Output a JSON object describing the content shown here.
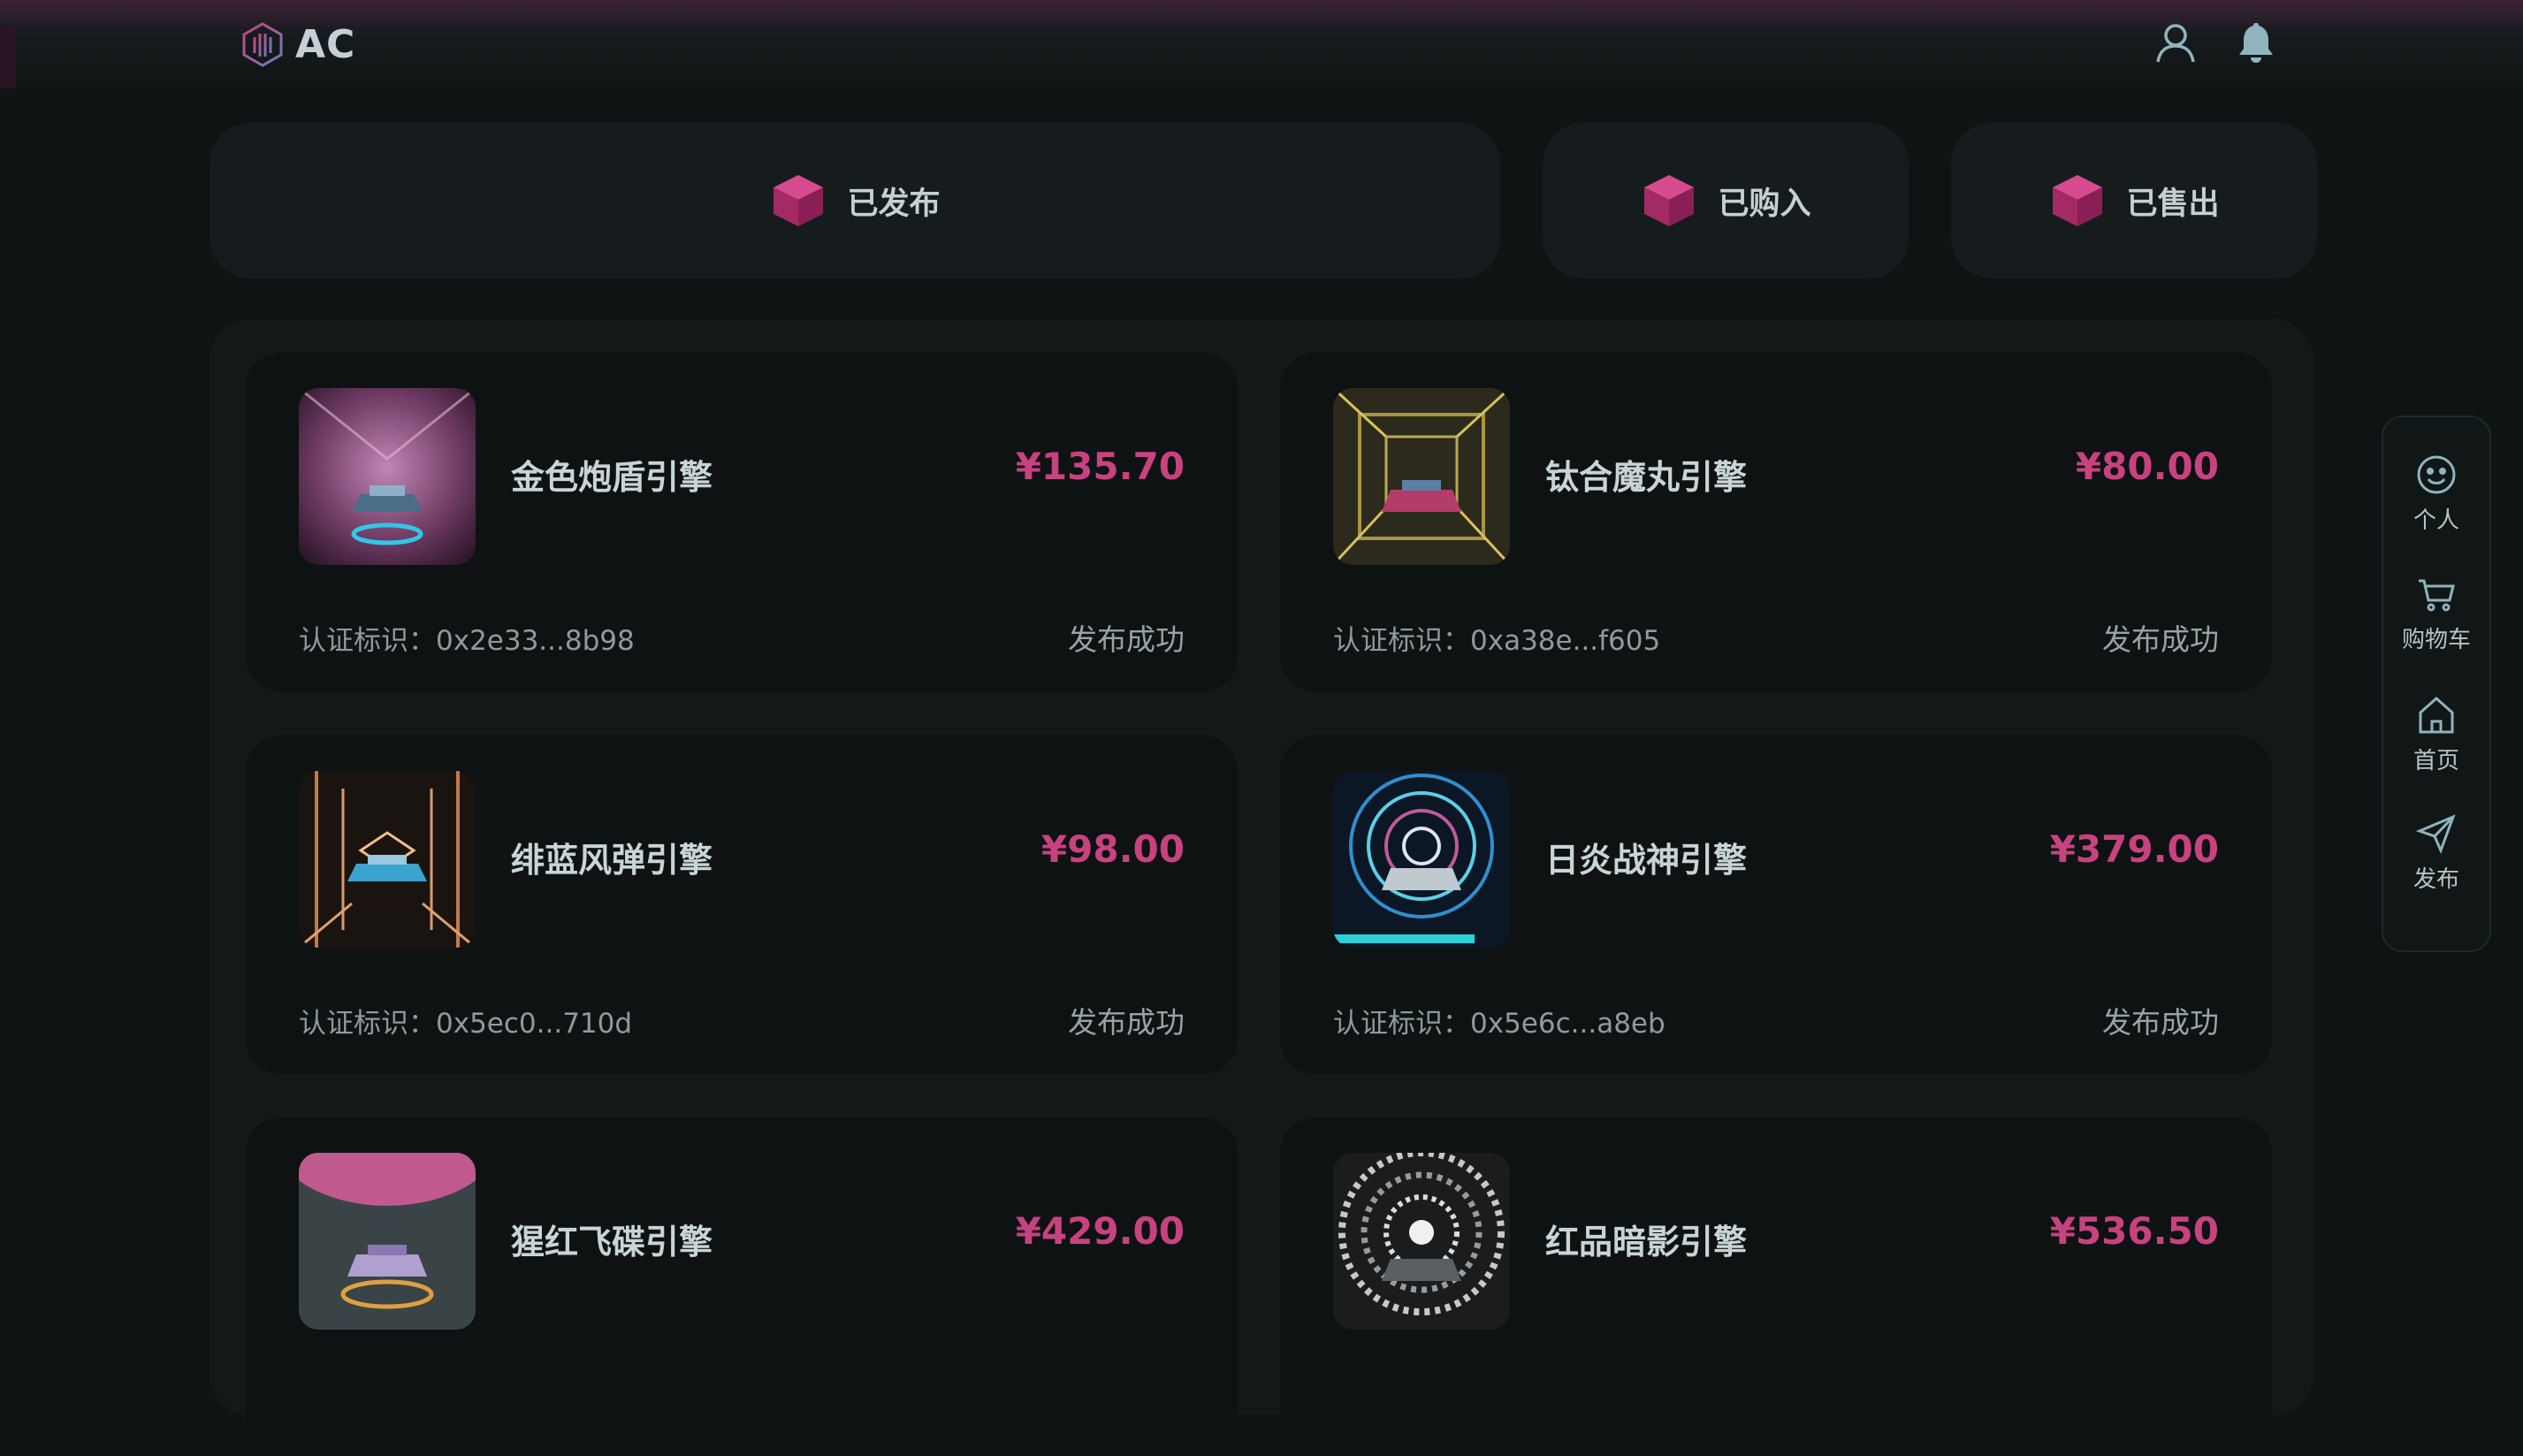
{
  "header": {
    "logo_text": "AC",
    "user_icon": "user-icon",
    "bell_icon": "bell-icon"
  },
  "tabs": [
    {
      "label": "已发布",
      "icon": "cube-icon"
    },
    {
      "label": "已购入",
      "icon": "cube-icon"
    },
    {
      "label": "已售出",
      "icon": "cube-icon"
    }
  ],
  "cards": [
    {
      "name": "金色炮盾引擎",
      "price": "¥135.70",
      "id_label": "认证标识：",
      "id_value": "0x2e33...8b98",
      "status": "发布成功"
    },
    {
      "name": "钛合魔丸引擎",
      "price": "¥80.00",
      "id_label": "认证标识：",
      "id_value": "0xa38e...f605",
      "status": "发布成功"
    },
    {
      "name": "绯蓝风弹引擎",
      "price": "¥98.00",
      "id_label": "认证标识：",
      "id_value": "0x5ec0...710d",
      "status": "发布成功"
    },
    {
      "name": "日炎战神引擎",
      "price": "¥379.00",
      "id_label": "认证标识：",
      "id_value": "0x5e6c...a8eb",
      "status": "发布成功"
    },
    {
      "name": "猩红飞碟引擎",
      "price": "¥429.00"
    },
    {
      "name": "红品暗影引擎",
      "price": "¥536.50"
    }
  ],
  "sidebar": [
    {
      "label": "个人",
      "icon": "smiley-icon"
    },
    {
      "label": "购物车",
      "icon": "cart-icon"
    },
    {
      "label": "首页",
      "icon": "home-icon"
    },
    {
      "label": "发布",
      "icon": "send-icon"
    }
  ],
  "colors": {
    "background": "#0f1314",
    "card": "#0e1213",
    "accent": "#c8427f",
    "text": "#c9d4d6"
  }
}
